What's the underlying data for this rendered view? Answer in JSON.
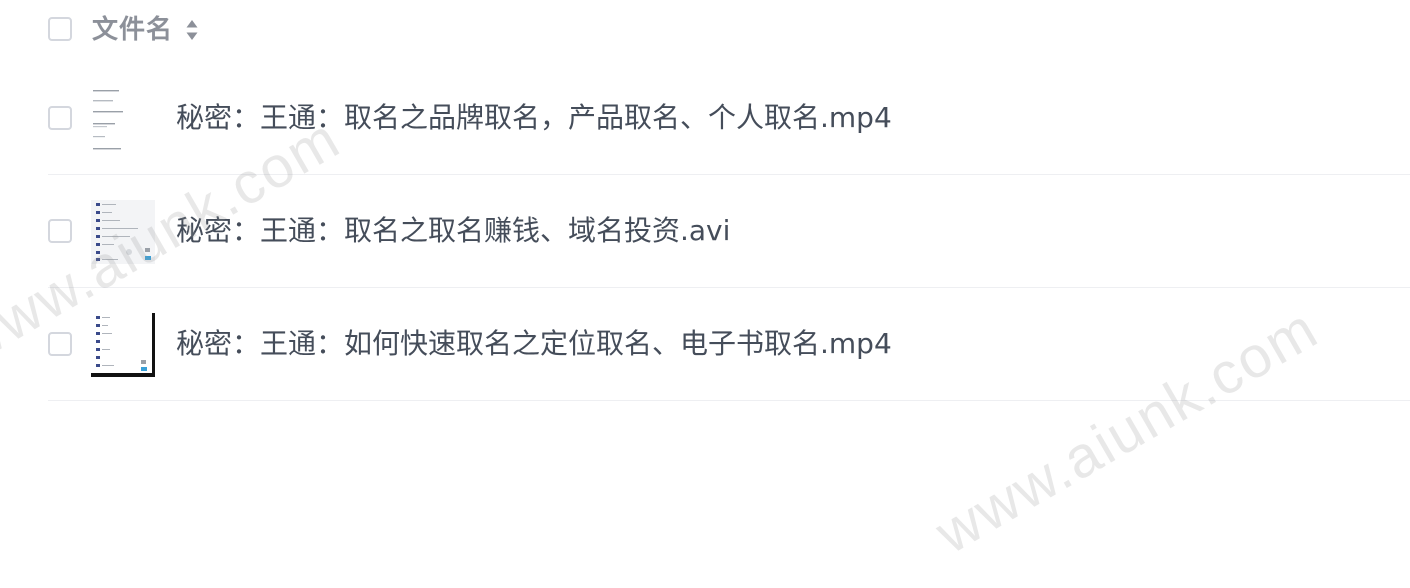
{
  "header": {
    "column_label": "文件名",
    "sort_icon": "sort-updown-icon"
  },
  "files": [
    {
      "name": "秘密：王通：取名之品牌取名，产品取名、个人取名.mp4",
      "thumbnail": "text-document-thumbnail"
    },
    {
      "name": "秘密：王通：取名之取名赚钱、域名投资.avi",
      "thumbnail": "file-list-thumbnail"
    },
    {
      "name": "秘密：王通：如何快速取名之定位取名、电子书取名.mp4",
      "thumbnail": "file-list-thumbnail-dark"
    }
  ],
  "watermark": {
    "text": "www.aiunk.com"
  },
  "colors": {
    "text": "#454d5a",
    "header_text": "#8c9099",
    "checkbox_border": "#d4d7de",
    "row_divider": "#eeeff2",
    "watermark": "#969696"
  }
}
